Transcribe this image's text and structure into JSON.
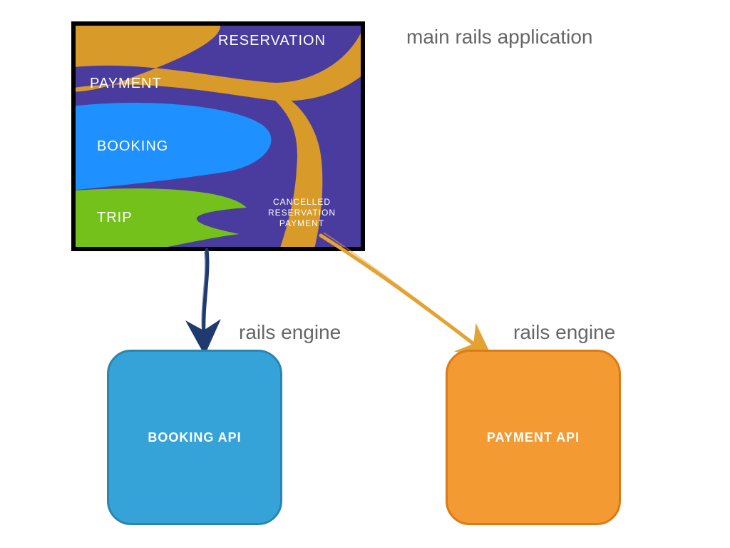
{
  "title": "main rails application",
  "monolith": {
    "reservation": "RESERVATION",
    "payment": "PAYMENT",
    "booking": "BOOKING",
    "trip": "TRIP",
    "cancelled": "CANCELLED\nRESERVATION\nPAYMENT"
  },
  "engines": {
    "booking": {
      "label": "BOOKING API",
      "caption": "rails engine"
    },
    "payment": {
      "label": "PAYMENT API",
      "caption": "rails engine"
    }
  },
  "colors": {
    "reservation_bg": "#4A3C9E",
    "payment_blob": "#D89B2A",
    "booking_blob": "#1E90FF",
    "trip_blob": "#74C11C",
    "booking_box": "#35A3D8",
    "payment_box": "#F39A32",
    "arrow_blue": "#1F3A6E",
    "arrow_orange": "#E3A233"
  }
}
